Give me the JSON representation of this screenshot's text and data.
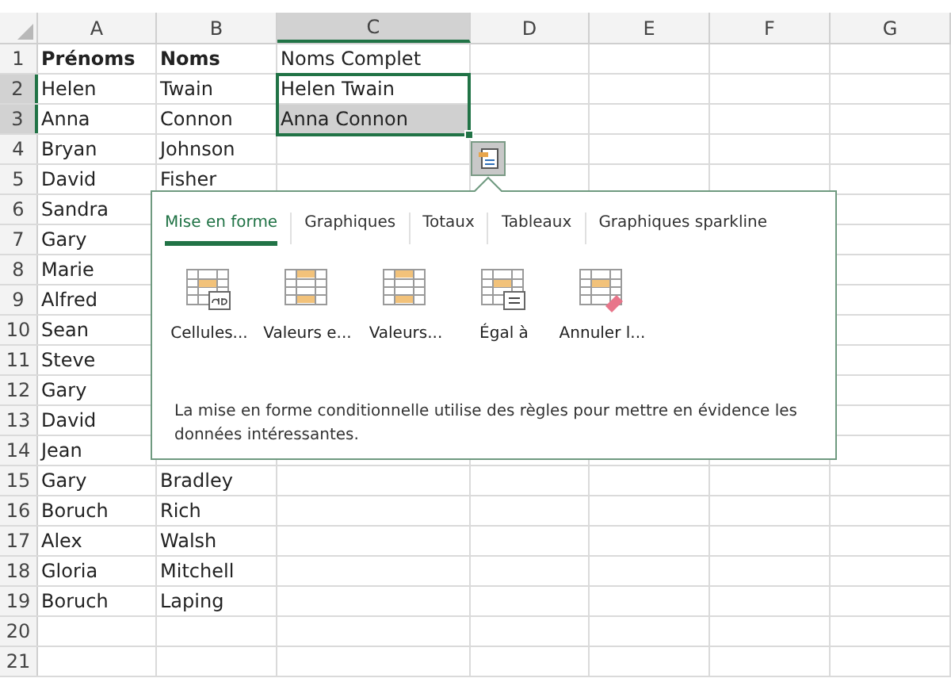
{
  "columns": [
    {
      "label": "A",
      "selected": false
    },
    {
      "label": "B",
      "selected": false
    },
    {
      "label": "C",
      "selected": true
    },
    {
      "label": "D",
      "selected": false
    },
    {
      "label": "E",
      "selected": false
    },
    {
      "label": "F",
      "selected": false
    },
    {
      "label": "G",
      "selected": false
    }
  ],
  "rows": [
    {
      "num": "1",
      "kind": "header",
      "a": "Prénoms",
      "b": "Noms",
      "c": {
        "text": "Noms Complet",
        "highlighted": false
      },
      "selected": false
    },
    {
      "num": "2",
      "kind": "data",
      "a": "Helen",
      "b": "Twain",
      "c": {
        "text": "Helen Twain",
        "highlighted": false
      },
      "selected": true
    },
    {
      "num": "3",
      "kind": "data",
      "a": "Anna",
      "b": "Connon",
      "c": {
        "text": "Anna Connon",
        "highlighted": true
      },
      "selected": true
    },
    {
      "num": "4",
      "kind": "data",
      "a": "Bryan",
      "b": "Johnson",
      "selected": false
    },
    {
      "num": "5",
      "kind": "data",
      "a": "David",
      "b": "Fisher",
      "selected": false
    },
    {
      "num": "6",
      "kind": "data",
      "a": "Sandra",
      "selected": false
    },
    {
      "num": "7",
      "kind": "data",
      "a": "Gary",
      "selected": false
    },
    {
      "num": "8",
      "kind": "data",
      "a": "Marie",
      "selected": false
    },
    {
      "num": "9",
      "kind": "data",
      "a": "Alfred",
      "selected": false
    },
    {
      "num": "10",
      "kind": "data",
      "a": "Sean",
      "selected": false
    },
    {
      "num": "11",
      "kind": "data",
      "a": "Steve",
      "selected": false
    },
    {
      "num": "12",
      "kind": "data",
      "a": "Gary",
      "selected": false
    },
    {
      "num": "13",
      "kind": "data",
      "a": "David",
      "selected": false
    },
    {
      "num": "14",
      "kind": "data",
      "a": "Jean",
      "selected": false
    },
    {
      "num": "15",
      "kind": "data",
      "a": "Gary",
      "b": "Bradley",
      "selected": false
    },
    {
      "num": "16",
      "kind": "data",
      "a": "Boruch",
      "b": "Rich",
      "selected": false
    },
    {
      "num": "17",
      "kind": "data",
      "a": "Alex",
      "b": "Walsh",
      "selected": false
    },
    {
      "num": "18",
      "kind": "data",
      "a": "Gloria",
      "b": "Mitchell",
      "selected": false
    },
    {
      "num": "19",
      "kind": "data",
      "a": "Boruch",
      "b": "Laping",
      "selected": false
    },
    {
      "num": "20",
      "kind": "data",
      "selected": false
    },
    {
      "num": "21",
      "kind": "data",
      "selected": false
    }
  ],
  "quick_analysis": {
    "tabs": [
      {
        "label": "Mise en forme",
        "selected": true
      },
      {
        "label": "Graphiques",
        "selected": false
      },
      {
        "label": "Totaux",
        "selected": false
      },
      {
        "label": "Tableaux",
        "selected": false
      },
      {
        "label": "Graphiques sparkline",
        "selected": false
      }
    ],
    "options": [
      {
        "kind": "text",
        "label": "Cellules..."
      },
      {
        "kind": "between",
        "label": "Valeurs e..."
      },
      {
        "kind": "top",
        "label": "Valeurs..."
      },
      {
        "kind": "equal",
        "label": "Égal à"
      },
      {
        "kind": "clear",
        "label": "Annuler l..."
      }
    ],
    "description": "La mise en forme conditionnelle utilise des règles pour mettre en évidence les données intéressantes."
  }
}
